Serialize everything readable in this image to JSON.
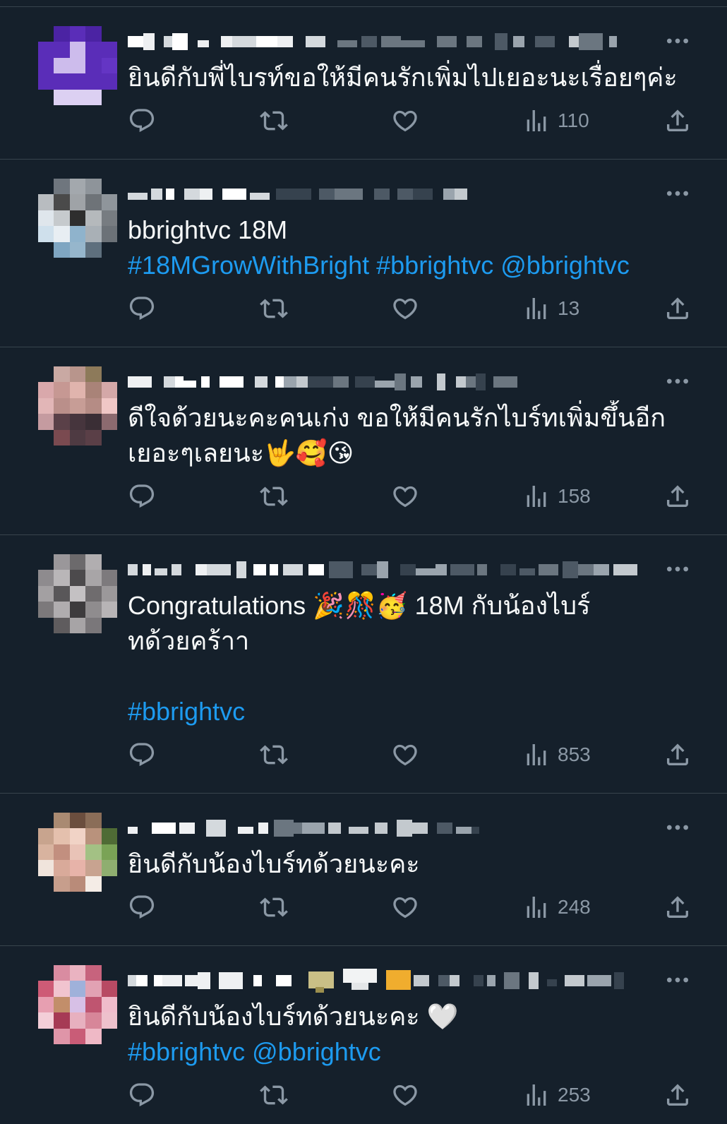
{
  "theme": {
    "bg": "#15202b",
    "text": "#f7f9f9",
    "muted": "#8b98a5",
    "link": "#1d9bf0",
    "divider": "#38444d"
  },
  "icons": {
    "more": "more-icon",
    "reply": "reply-icon",
    "repost": "repost-icon",
    "like": "heart-icon",
    "views": "views-icon",
    "share": "share-icon"
  },
  "replies": [
    {
      "lines": [
        {
          "text": "ยินดีกับพี่ไบรท์ขอให้มีคนรักเพิ่มไปเยอะนะเรื่อยๆค่ะ"
        }
      ],
      "views": "110"
    },
    {
      "lines": [
        {
          "text": "bbrightvc 18M"
        },
        {
          "links": [
            "#18MGrowWithBright",
            "#bbrightvc",
            "@bbrightvc"
          ]
        }
      ],
      "views": "13"
    },
    {
      "lines": [
        {
          "text": "ดีใจด้วยนะคะคนเก่ง ขอให้มีคนรักไบร์ทเพิ่มขึ้นอีก"
        },
        {
          "text": "เยอะๆเลยนะ🤟🥰😘"
        }
      ],
      "views": "158"
    },
    {
      "lines": [
        {
          "text": "Congratulations 🎉🎊🥳 18M กับน้องไบร์"
        },
        {
          "text": "ทด้วยคร้าา"
        },
        {
          "text": ""
        },
        {
          "links": [
            "#bbrightvc"
          ]
        }
      ],
      "views": "853"
    },
    {
      "lines": [
        {
          "text": "ยินดีกับน้องไบร์ทด้วยนะคะ"
        }
      ],
      "views": "248"
    },
    {
      "lines": [
        {
          "text": "ยินดีกับน้องไบร์ทด้วยนะคะ 🤍"
        },
        {
          "links": [
            "#bbrightvc",
            "@bbrightvc"
          ]
        }
      ],
      "views": "253"
    }
  ]
}
